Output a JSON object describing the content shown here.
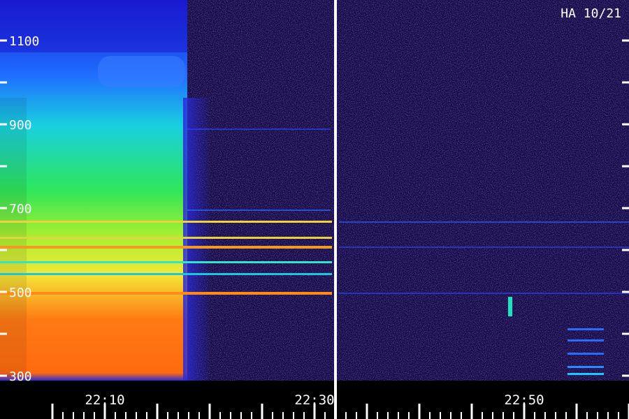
{
  "chart_data": {
    "type": "heatmap",
    "title": "",
    "annotation": "HA 10/21",
    "xlabel": "",
    "ylabel": "",
    "x_ticks": [
      "22:10",
      "22:30",
      "22:50"
    ],
    "y_ticks": [
      "300",
      "500",
      "700",
      "900",
      "1100"
    ],
    "y_range": [
      300,
      1100
    ],
    "colors": {
      "background": "#000000",
      "noise": "#1c0b5e",
      "low": "#2a2ad8",
      "mid": "#19e3e8",
      "high": "#2ee65a",
      "peak": "#ff6a10",
      "axis": "#ffffff"
    }
  }
}
